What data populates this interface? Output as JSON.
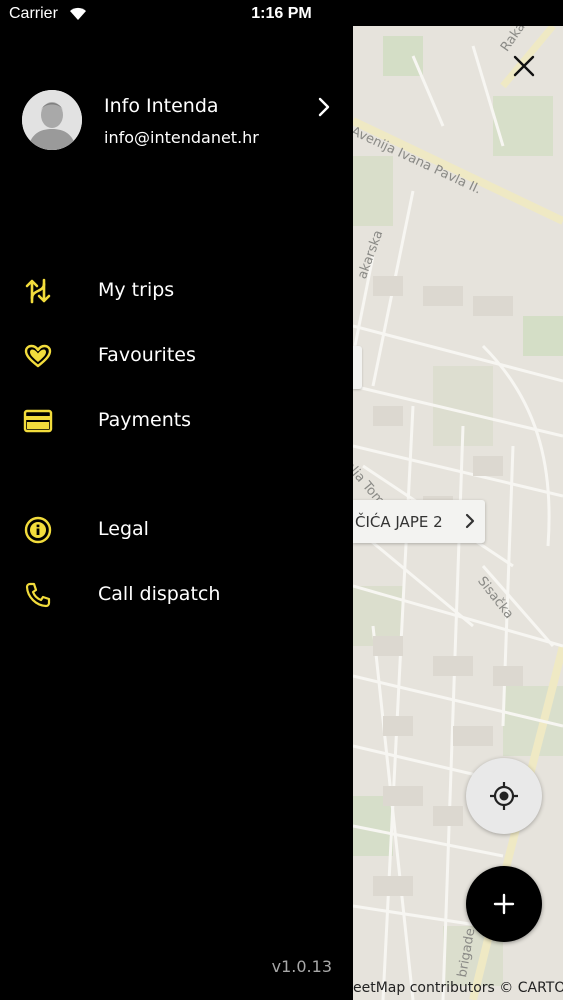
{
  "status_bar": {
    "carrier": "Carrier",
    "time": "1:16 PM"
  },
  "profile": {
    "name": "Info Intenda",
    "email": "info@intendanet.hr"
  },
  "menu": {
    "my_trips": "My trips",
    "favourites": "Favourites",
    "payments": "Payments",
    "legal": "Legal",
    "call_dispatch": "Call dispatch"
  },
  "version": "v1.0.13",
  "map": {
    "streets": {
      "avenija": "Avenija Ivana Pavla II.",
      "rakarska": "Rakarska",
      "makarska": "akarska",
      "tome": "alja Tom",
      "sisacka": "Sisačka",
      "brigade": "brigade"
    },
    "address_chip": "ČIĆA JAPE 2",
    "attribution": "eetMap contributors © CARTO"
  },
  "colors": {
    "accent": "#f2dc3c",
    "drawer_bg": "#000000",
    "map_bg": "#e6e3dc"
  },
  "icons": {
    "my_trips": "swap-arrows-icon",
    "favourites": "heart-icon",
    "payments": "card-icon",
    "legal": "info-icon",
    "call_dispatch": "phone-icon"
  }
}
